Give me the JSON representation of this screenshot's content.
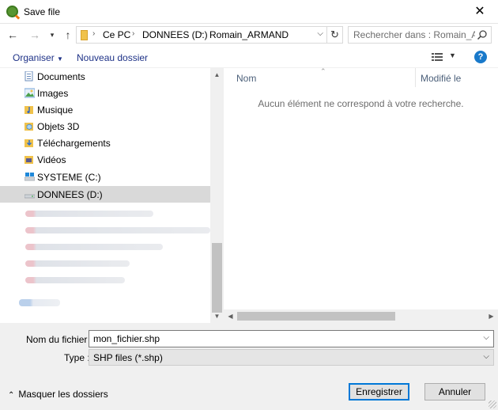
{
  "window": {
    "title": "Save file"
  },
  "address_bar": {
    "crumbs": [
      "Ce PC",
      "DONNEES (D:)",
      "Romain_ARMAND"
    ],
    "search_placeholder": "Rechercher dans : Romain_AR..."
  },
  "toolbar": {
    "organize_label": "Organiser",
    "new_folder_label": "Nouveau dossier",
    "help_label": "?"
  },
  "nav_tree": {
    "items": [
      {
        "label": "Documents",
        "icon": "documents-icon"
      },
      {
        "label": "Images",
        "icon": "images-icon"
      },
      {
        "label": "Musique",
        "icon": "music-icon"
      },
      {
        "label": "Objets 3D",
        "icon": "objects-3d-icon"
      },
      {
        "label": "Téléchargements",
        "icon": "downloads-icon"
      },
      {
        "label": "Vidéos",
        "icon": "videos-icon"
      },
      {
        "label": "SYSTEME (C:)",
        "icon": "system-drive-icon"
      },
      {
        "label": "DONNEES (D:)",
        "icon": "data-drive-icon",
        "selected": true
      }
    ]
  },
  "file_list": {
    "columns": [
      "Nom",
      "Modifié le"
    ],
    "empty_message": "Aucun élément ne correspond à votre recherche."
  },
  "form": {
    "filename_label": "Nom du fichier :",
    "filename_value": "mon_fichier.shp",
    "type_label": "Type :",
    "type_value": "SHP files (*.shp)"
  },
  "footer": {
    "hide_folders_label": "Masquer les dossiers",
    "save_label": "Enregistrer",
    "cancel_label": "Annuler"
  },
  "colors": {
    "selection": "#d9d9d9",
    "link_text": "#1e3287",
    "primary_border": "#0078d7",
    "help": "#1979ca"
  }
}
